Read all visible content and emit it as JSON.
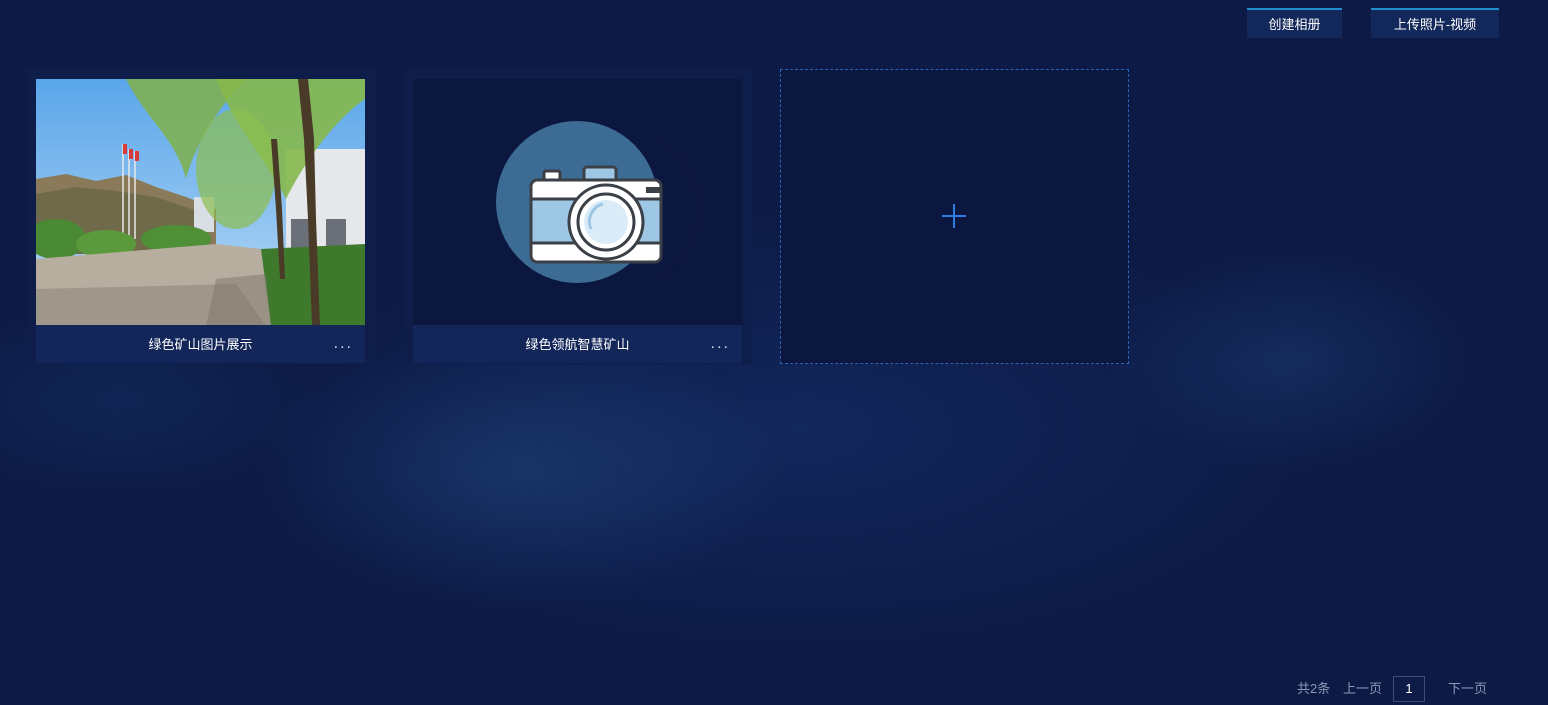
{
  "toolbar": {
    "create_album_label": "创建相册",
    "upload_label": "上传照片-视频"
  },
  "albums": [
    {
      "title": "绿色矿山图片展示",
      "thumbnail": "mine-park-photo",
      "more": "..."
    },
    {
      "title": "绿色领航智慧矿山",
      "thumbnail": "camera-icon",
      "more": "..."
    }
  ],
  "add_album": {
    "icon": "plus-icon"
  },
  "pagination": {
    "total": "共2条",
    "prev": "上一页",
    "current": "1",
    "next": "下一页"
  },
  "colors": {
    "background": "#0d1a45",
    "card": "#0f1d4a",
    "caption": "#13265a",
    "accent": "#1e8ed0",
    "dashed_border": "#2b64b6"
  }
}
